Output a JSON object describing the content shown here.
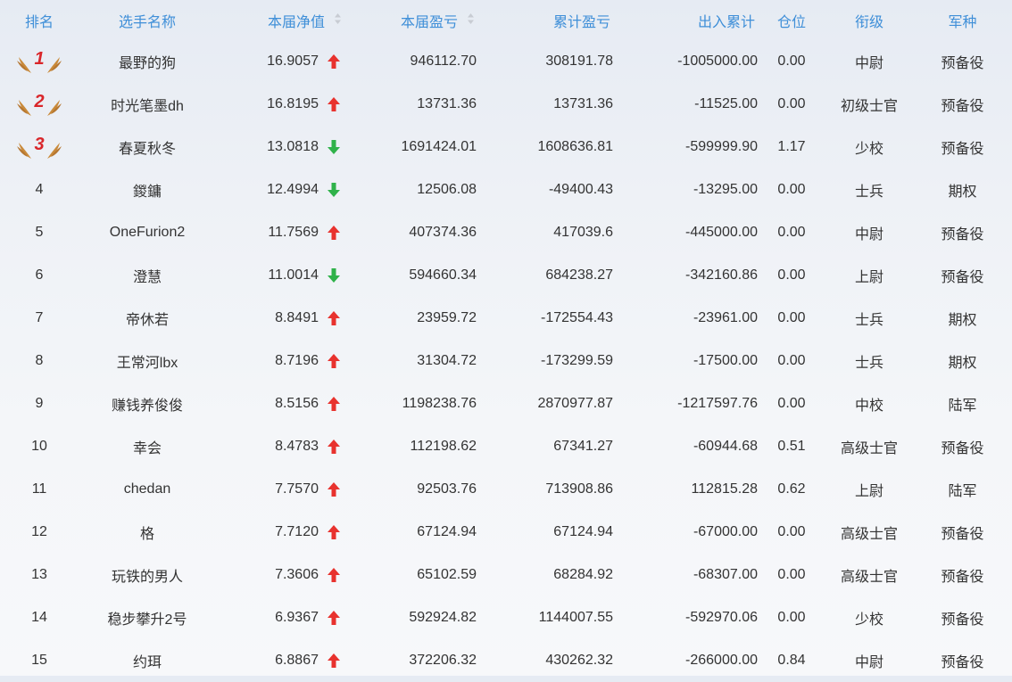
{
  "header": {
    "rank": "排名",
    "name": "选手名称",
    "nav": "本届净值",
    "current_pnl": "本届盈亏",
    "cumulative_pnl": "累计盈亏",
    "in_out": "出入累计",
    "position": "仓位",
    "rank_title": "衔级",
    "army": "军种"
  },
  "colors": {
    "header_text": "#3f8fd8",
    "up_arrow": "#e8322e",
    "down_arrow": "#2fb24a",
    "medal_digit": "#d9262a",
    "medal_wing": "#c98a3a"
  },
  "rows": [
    {
      "rank": "1",
      "medal": true,
      "name": "最野的狗",
      "nav": "16.9057",
      "trend": "up",
      "current_pnl": "946112.70",
      "cumulative_pnl": "308191.78",
      "in_out": "-1005000.00",
      "position": "0.00",
      "rank_title": "中尉",
      "army": "预备役"
    },
    {
      "rank": "2",
      "medal": true,
      "name": "时光笔墨dh",
      "nav": "16.8195",
      "trend": "up",
      "current_pnl": "13731.36",
      "cumulative_pnl": "13731.36",
      "in_out": "-11525.00",
      "position": "0.00",
      "rank_title": "初级士官",
      "army": "预备役"
    },
    {
      "rank": "3",
      "medal": true,
      "name": "春夏秋冬",
      "nav": "13.0818",
      "trend": "down",
      "current_pnl": "1691424.01",
      "cumulative_pnl": "1608636.81",
      "in_out": "-599999.90",
      "position": "1.17",
      "rank_title": "少校",
      "army": "预备役"
    },
    {
      "rank": "4",
      "medal": false,
      "name": "鍐鏞",
      "nav": "12.4994",
      "trend": "down",
      "current_pnl": "12506.08",
      "cumulative_pnl": "-49400.43",
      "in_out": "-13295.00",
      "position": "0.00",
      "rank_title": "士兵",
      "army": "期权"
    },
    {
      "rank": "5",
      "medal": false,
      "name": "OneFurion2",
      "nav": "11.7569",
      "trend": "up",
      "current_pnl": "407374.36",
      "cumulative_pnl": "417039.6",
      "in_out": "-445000.00",
      "position": "0.00",
      "rank_title": "中尉",
      "army": "预备役"
    },
    {
      "rank": "6",
      "medal": false,
      "name": "澄慧",
      "nav": "11.0014",
      "trend": "down",
      "current_pnl": "594660.34",
      "cumulative_pnl": "684238.27",
      "in_out": "-342160.86",
      "position": "0.00",
      "rank_title": "上尉",
      "army": "预备役"
    },
    {
      "rank": "7",
      "medal": false,
      "name": "帝休若",
      "nav": "8.8491",
      "trend": "up",
      "current_pnl": "23959.72",
      "cumulative_pnl": "-172554.43",
      "in_out": "-23961.00",
      "position": "0.00",
      "rank_title": "士兵",
      "army": "期权"
    },
    {
      "rank": "8",
      "medal": false,
      "name": "王常河lbx",
      "nav": "8.7196",
      "trend": "up",
      "current_pnl": "31304.72",
      "cumulative_pnl": "-173299.59",
      "in_out": "-17500.00",
      "position": "0.00",
      "rank_title": "士兵",
      "army": "期权"
    },
    {
      "rank": "9",
      "medal": false,
      "name": "赚钱养俊俊",
      "nav": "8.5156",
      "trend": "up",
      "current_pnl": "1198238.76",
      "cumulative_pnl": "2870977.87",
      "in_out": "-1217597.76",
      "position": "0.00",
      "rank_title": "中校",
      "army": "陆军"
    },
    {
      "rank": "10",
      "medal": false,
      "name": "幸会",
      "nav": "8.4783",
      "trend": "up",
      "current_pnl": "112198.62",
      "cumulative_pnl": "67341.27",
      "in_out": "-60944.68",
      "position": "0.51",
      "rank_title": "高级士官",
      "army": "预备役"
    },
    {
      "rank": "11",
      "medal": false,
      "name": "chedan",
      "nav": "7.7570",
      "trend": "up",
      "current_pnl": "92503.76",
      "cumulative_pnl": "713908.86",
      "in_out": "112815.28",
      "position": "0.62",
      "rank_title": "上尉",
      "army": "陆军"
    },
    {
      "rank": "12",
      "medal": false,
      "name": "格",
      "nav": "7.7120",
      "trend": "up",
      "current_pnl": "67124.94",
      "cumulative_pnl": "67124.94",
      "in_out": "-67000.00",
      "position": "0.00",
      "rank_title": "高级士官",
      "army": "预备役"
    },
    {
      "rank": "13",
      "medal": false,
      "name": "玩铁的男人",
      "nav": "7.3606",
      "trend": "up",
      "current_pnl": "65102.59",
      "cumulative_pnl": "68284.92",
      "in_out": "-68307.00",
      "position": "0.00",
      "rank_title": "高级士官",
      "army": "预备役"
    },
    {
      "rank": "14",
      "medal": false,
      "name": "稳步攀升2号",
      "nav": "6.9367",
      "trend": "up",
      "current_pnl": "592924.82",
      "cumulative_pnl": "1144007.55",
      "in_out": "-592970.06",
      "position": "0.00",
      "rank_title": "少校",
      "army": "预备役"
    },
    {
      "rank": "15",
      "medal": false,
      "name": "约珥",
      "nav": "6.8867",
      "trend": "up",
      "current_pnl": "372206.32",
      "cumulative_pnl": "430262.32",
      "in_out": "-266000.00",
      "position": "0.84",
      "rank_title": "中尉",
      "army": "预备役"
    }
  ]
}
